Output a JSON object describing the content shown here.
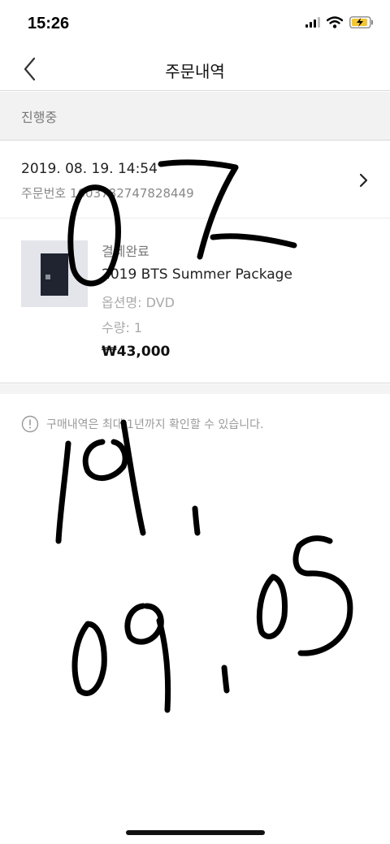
{
  "status_bar": {
    "time": "15:26",
    "icons": [
      "signal-icon",
      "wifi-icon",
      "battery-charging-icon"
    ]
  },
  "nav": {
    "title": "주문내역",
    "back_icon": "chevron-left-icon"
  },
  "section": {
    "label": "진행중"
  },
  "order": {
    "date": "2019. 08. 19. 14:54",
    "order_number": "주문번호 1603782747828449",
    "detail_icon": "chevron-right-icon",
    "item": {
      "status": "결제완료",
      "name": "2019 BTS Summer Package",
      "option": "옵션명: DVD",
      "quantity": "수량: 1",
      "price": "₩43,000"
    }
  },
  "notice": {
    "icon": "info-circle-icon",
    "text": "구매내역은 최대 1년까지 확인할 수 있습니다."
  },
  "handwriting": {
    "annotation_1": "07",
    "annotation_2": "19.",
    "annotation_3": "09.05"
  },
  "colors": {
    "background": "#ffffff",
    "band": "#f2f2f2",
    "divider": "#d9d9d9",
    "muted_text": "#9a9a9a",
    "ink": "#000000"
  }
}
